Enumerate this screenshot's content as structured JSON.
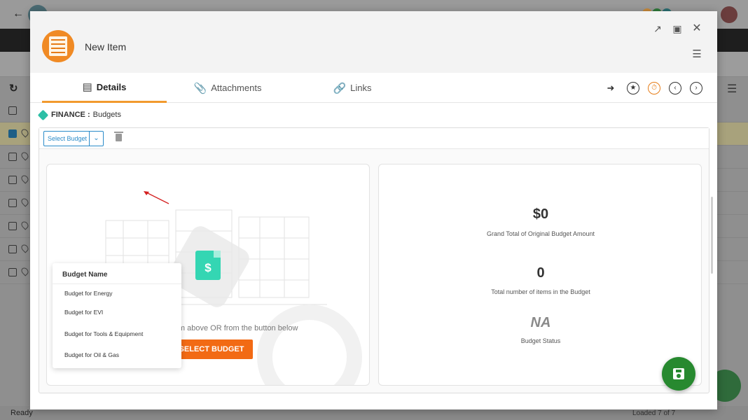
{
  "status_bar": {
    "left": "Ready",
    "right": "Loaded 7 of 7"
  },
  "modal": {
    "title": "New Item",
    "header_icons": [
      "external-link-icon",
      "maximize-icon",
      "close-icon",
      "hamburger-menu-icon"
    ]
  },
  "tabs": [
    {
      "label": "Details",
      "icon": "details-icon",
      "active": true
    },
    {
      "label": "Attachments",
      "icon": "paperclip-icon",
      "active": false
    },
    {
      "label": "Links",
      "icon": "link-icon",
      "active": false
    }
  ],
  "toolbar_icons": [
    "share-icon",
    "star-icon",
    "timer-icon",
    "prev-icon",
    "next-icon"
  ],
  "breadcrumb": {
    "module": "FINANCE :",
    "section": "Budgets"
  },
  "selector": {
    "label": "Select Budget"
  },
  "dropdown": {
    "header": "Budget Name",
    "items": [
      "Budget for Energy",
      "Budget for EVI",
      "Budget for Tools & Equipment",
      "Budget for Oil & Gas"
    ]
  },
  "left_card": {
    "hint": "Select Budget from above OR from the button below",
    "button": "SELECT BUDGET"
  },
  "right_card": {
    "grand_total_value": "$0",
    "grand_total_label": "Grand Total of Original Budget Amount",
    "items_count_value": "0",
    "items_count_label": "Total number of items in the Budget",
    "status_value": "NA",
    "status_label": "Budget Status"
  },
  "colors": {
    "accent_orange": "#f26a14",
    "tab_underline": "#f29a2e",
    "selector_blue": "#2a8bc9",
    "save_green": "#27892f",
    "doc_teal": "#34d6b3"
  }
}
